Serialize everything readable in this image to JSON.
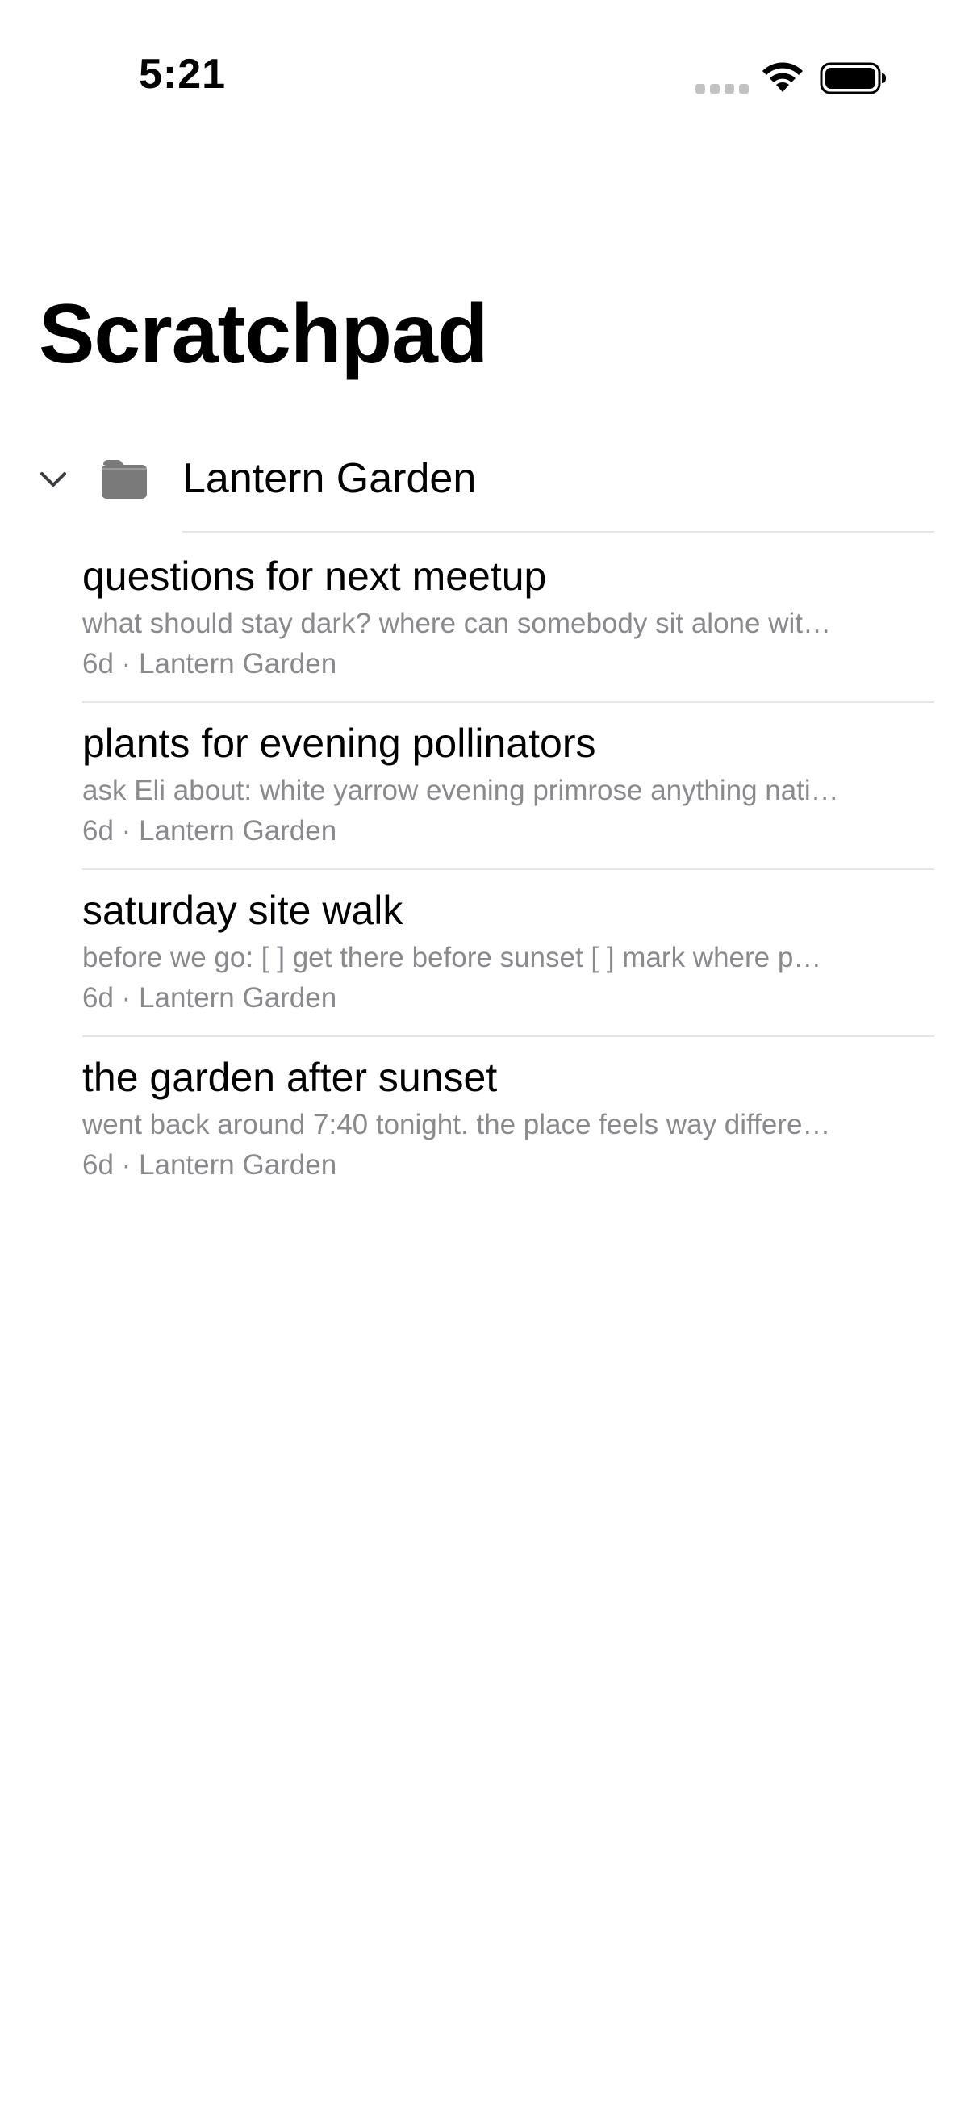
{
  "status_bar": {
    "time": "5:21"
  },
  "page": {
    "title": "Scratchpad"
  },
  "folder": {
    "name": "Lantern Garden"
  },
  "notes": [
    {
      "title": "questions for next meetup",
      "preview": "what should stay dark? where can somebody sit alone wit…",
      "meta": "6d · Lantern Garden"
    },
    {
      "title": "plants for evening pollinators",
      "preview": "ask Eli about: white yarrow evening primrose anything nati…",
      "meta": "6d · Lantern Garden"
    },
    {
      "title": "saturday site walk",
      "preview": "before we go: [ ] get there before sunset [ ] mark where p…",
      "meta": "6d · Lantern Garden"
    },
    {
      "title": "the garden after sunset",
      "preview": "went back around 7:40 tonight. the place feels way differe…",
      "meta": "6d · Lantern Garden"
    }
  ]
}
